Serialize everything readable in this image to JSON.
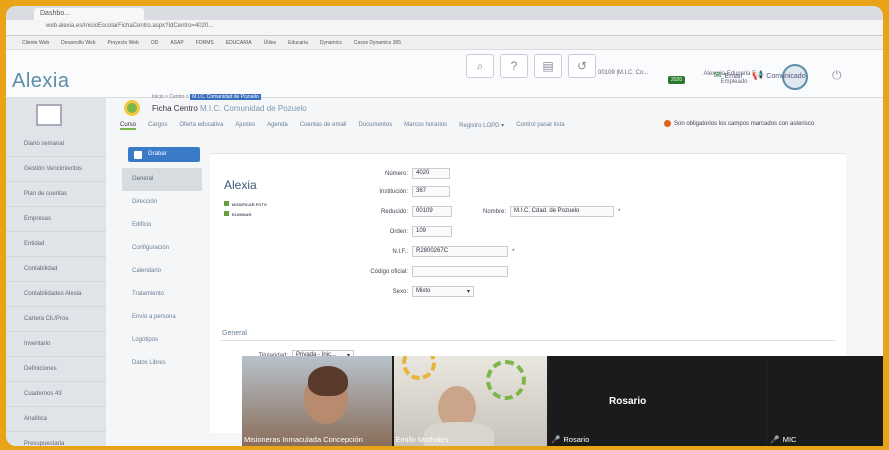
{
  "browser": {
    "tab_title": "Dashbo...",
    "url": "web.alexia.es/InicioEscolarFichaCentro.aspx?IdCentro=4020...",
    "bookmarks": [
      "Cliente Web",
      "Desarrollo Web",
      "Proyecto Web",
      "OD",
      "ASAP",
      "FORMS",
      "EDUCARIA",
      "Útiles",
      "Educaria",
      "Dynamics",
      "Casos Dynamics 365"
    ]
  },
  "header": {
    "brand": "Alexia",
    "centre_selector": "00109 |M.I.C. Co...",
    "badge": "2020",
    "user_name": "Alexoria Educaria Eu... Empleado",
    "email_label": "Email",
    "comunicado_label": "Comunicado"
  },
  "sidebar": {
    "items": [
      "Diario semanal",
      "Gestión Vencimientos",
      "Plan de cuentas",
      "Empresas",
      "Entidad",
      "Contabilidad",
      "Contabilidades Alexia",
      "Cartera Cli./Prov.",
      "Inventario",
      "Definiciones",
      "Cuadernos 43",
      "Analítica",
      "Presupuestaria"
    ]
  },
  "page": {
    "breadcrumb_prefix": "Inicio > Centro >",
    "breadcrumb_current": "M.I.C. Comunidad de Pozuelo",
    "title": "Ficha Centro",
    "subtitle": "M.I.C. Comunidad de Pozuelo",
    "tabs": [
      "Curso",
      "Cargos",
      "Oferta educativa",
      "Ajustes",
      "Agenda",
      "Cuentas de email",
      "Documentos",
      "Marcos horarios",
      "Registro LOPD ▾",
      "Control pasar lista"
    ],
    "required_note": "Son obligatorios los campos marcados con asterisco",
    "save_button": "Grabar",
    "subnav": [
      "General",
      "Dirección",
      "Edificio",
      "Configuración",
      "Calendario",
      "Tratamiento",
      "Envío a persona",
      "Logotipos",
      "Datos Libres"
    ]
  },
  "form": {
    "logo_text": "Alexia",
    "modify_photo": "MODIFICAR FOTO",
    "delete_photo": "ELIMINAR",
    "numero_label": "Número:",
    "numero_value": "4020",
    "institucion_label": "Institución:",
    "institucion_value": "367",
    "reducido_label": "Reducido:",
    "reducido_value": "00109",
    "nombre_label": "Nombre:",
    "nombre_value": "M.I.C. Cdad. de Pozuelo",
    "orden_label": "Orden:",
    "orden_value": "109",
    "nif_label": "N.I.F.:",
    "nif_value": "R2800267C",
    "codigo_label": "Código oficial:",
    "codigo_value": "",
    "sexo_label": "Sexo:",
    "sexo_value": "Mixto",
    "section_general": "General",
    "titularidad_label": "Titularidad:",
    "titularidad_value": "Privada - Inic..."
  },
  "video": {
    "participants": [
      "Misioneras Inmaculada Concepción",
      "Emilio Mothales",
      "Rosario",
      "MIC"
    ],
    "center_name": "Rosario"
  }
}
